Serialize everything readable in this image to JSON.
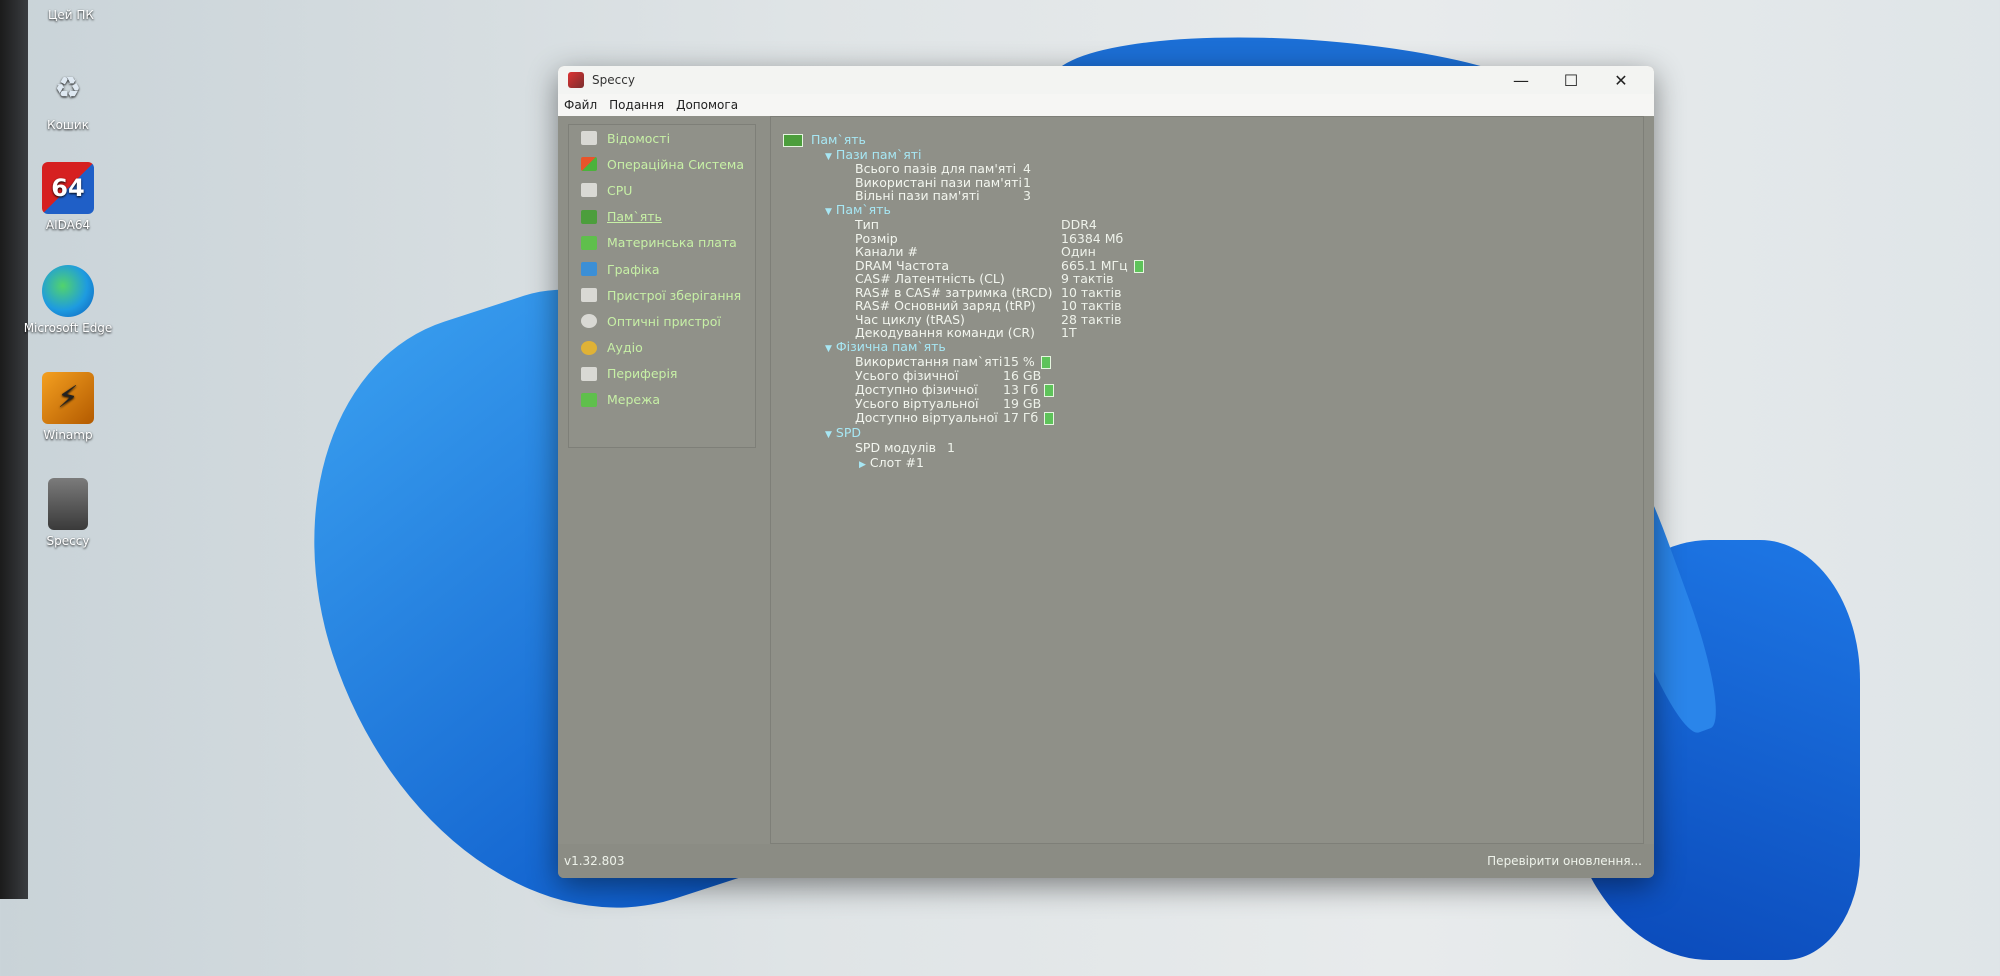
{
  "desktop": {
    "top_label": "Цей ПК",
    "icons": [
      {
        "label": "Кошик",
        "icon": "recycle-bin-icon"
      },
      {
        "label": "AIDA64",
        "icon": "aida64-icon"
      },
      {
        "label": "Microsoft Edge",
        "icon": "edge-icon"
      },
      {
        "label": "Winamp",
        "icon": "winamp-icon"
      },
      {
        "label": "Speccy",
        "icon": "speccy-icon"
      }
    ]
  },
  "window": {
    "title": "Speccy",
    "controls": {
      "minimize": "—",
      "maximize": "☐",
      "close": "✕"
    },
    "menu": [
      "Файл",
      "Подання",
      "Допомога"
    ],
    "sidebar": [
      {
        "label": "Відомості",
        "icon": "summary-icon"
      },
      {
        "label": "Операційна Система",
        "icon": "windows-icon"
      },
      {
        "label": "CPU",
        "icon": "cpu-icon"
      },
      {
        "label": "Пам`ять",
        "icon": "ram-icon",
        "active": true
      },
      {
        "label": "Материнська плата",
        "icon": "motherboard-icon"
      },
      {
        "label": "Графіка",
        "icon": "monitor-icon"
      },
      {
        "label": "Пристрої зберігання",
        "icon": "hdd-icon"
      },
      {
        "label": "Оптичні пристрої",
        "icon": "disc-icon"
      },
      {
        "label": "Аудіо",
        "icon": "audio-icon"
      },
      {
        "label": "Периферія",
        "icon": "mouse-icon"
      },
      {
        "label": "Мережа",
        "icon": "network-icon"
      }
    ],
    "content": {
      "header": "Пам`ять",
      "slots_section": "Пази пам`яті",
      "slots": [
        {
          "key": "Всього пазів для пам'яті",
          "value": "4"
        },
        {
          "key": "Використані пази пам'яті",
          "value": "1"
        },
        {
          "key": "Вільні пази пам'яті",
          "value": "3"
        }
      ],
      "memory_section": "Пам`ять",
      "memory": [
        {
          "key": "Тип",
          "value": "DDR4"
        },
        {
          "key": "Розмір",
          "value": "16384 Мб"
        },
        {
          "key": "Канали #",
          "value": "Один"
        },
        {
          "key": "DRAM Частота",
          "value": "665.1 МГц",
          "bar": true
        },
        {
          "key": "CAS# Латентність (CL)",
          "value": "9 тактів"
        },
        {
          "key": "RAS# в CAS# затримка (tRCD)",
          "value": "10 тактів"
        },
        {
          "key": "RAS# Основний заряд (tRP)",
          "value": "10 тактів"
        },
        {
          "key": "Час циклу (tRAS)",
          "value": "28 тактів"
        },
        {
          "key": "Декодування команди (CR)",
          "value": "1T"
        }
      ],
      "physical_section": "Фізична пам`ять",
      "physical": [
        {
          "key": "Використання пам`яті",
          "value": "15 %",
          "bar": true
        },
        {
          "key": "Усього фізичної",
          "value": "16 GB"
        },
        {
          "key": "Доступно фізичної",
          "value": "13 Гб",
          "bar": true
        },
        {
          "key": "Усього віртуальної",
          "value": "19 GB"
        },
        {
          "key": "Доступно віртуальної",
          "value": "17 Гб",
          "bar": true
        }
      ],
      "spd_section": "SPD",
      "spd_modules_key": "SPD модулів",
      "spd_modules_value": "1",
      "slot_item": "Слот #1"
    },
    "footer": {
      "version": "v1.32.803",
      "update_link": "Перевірити оновлення..."
    }
  }
}
